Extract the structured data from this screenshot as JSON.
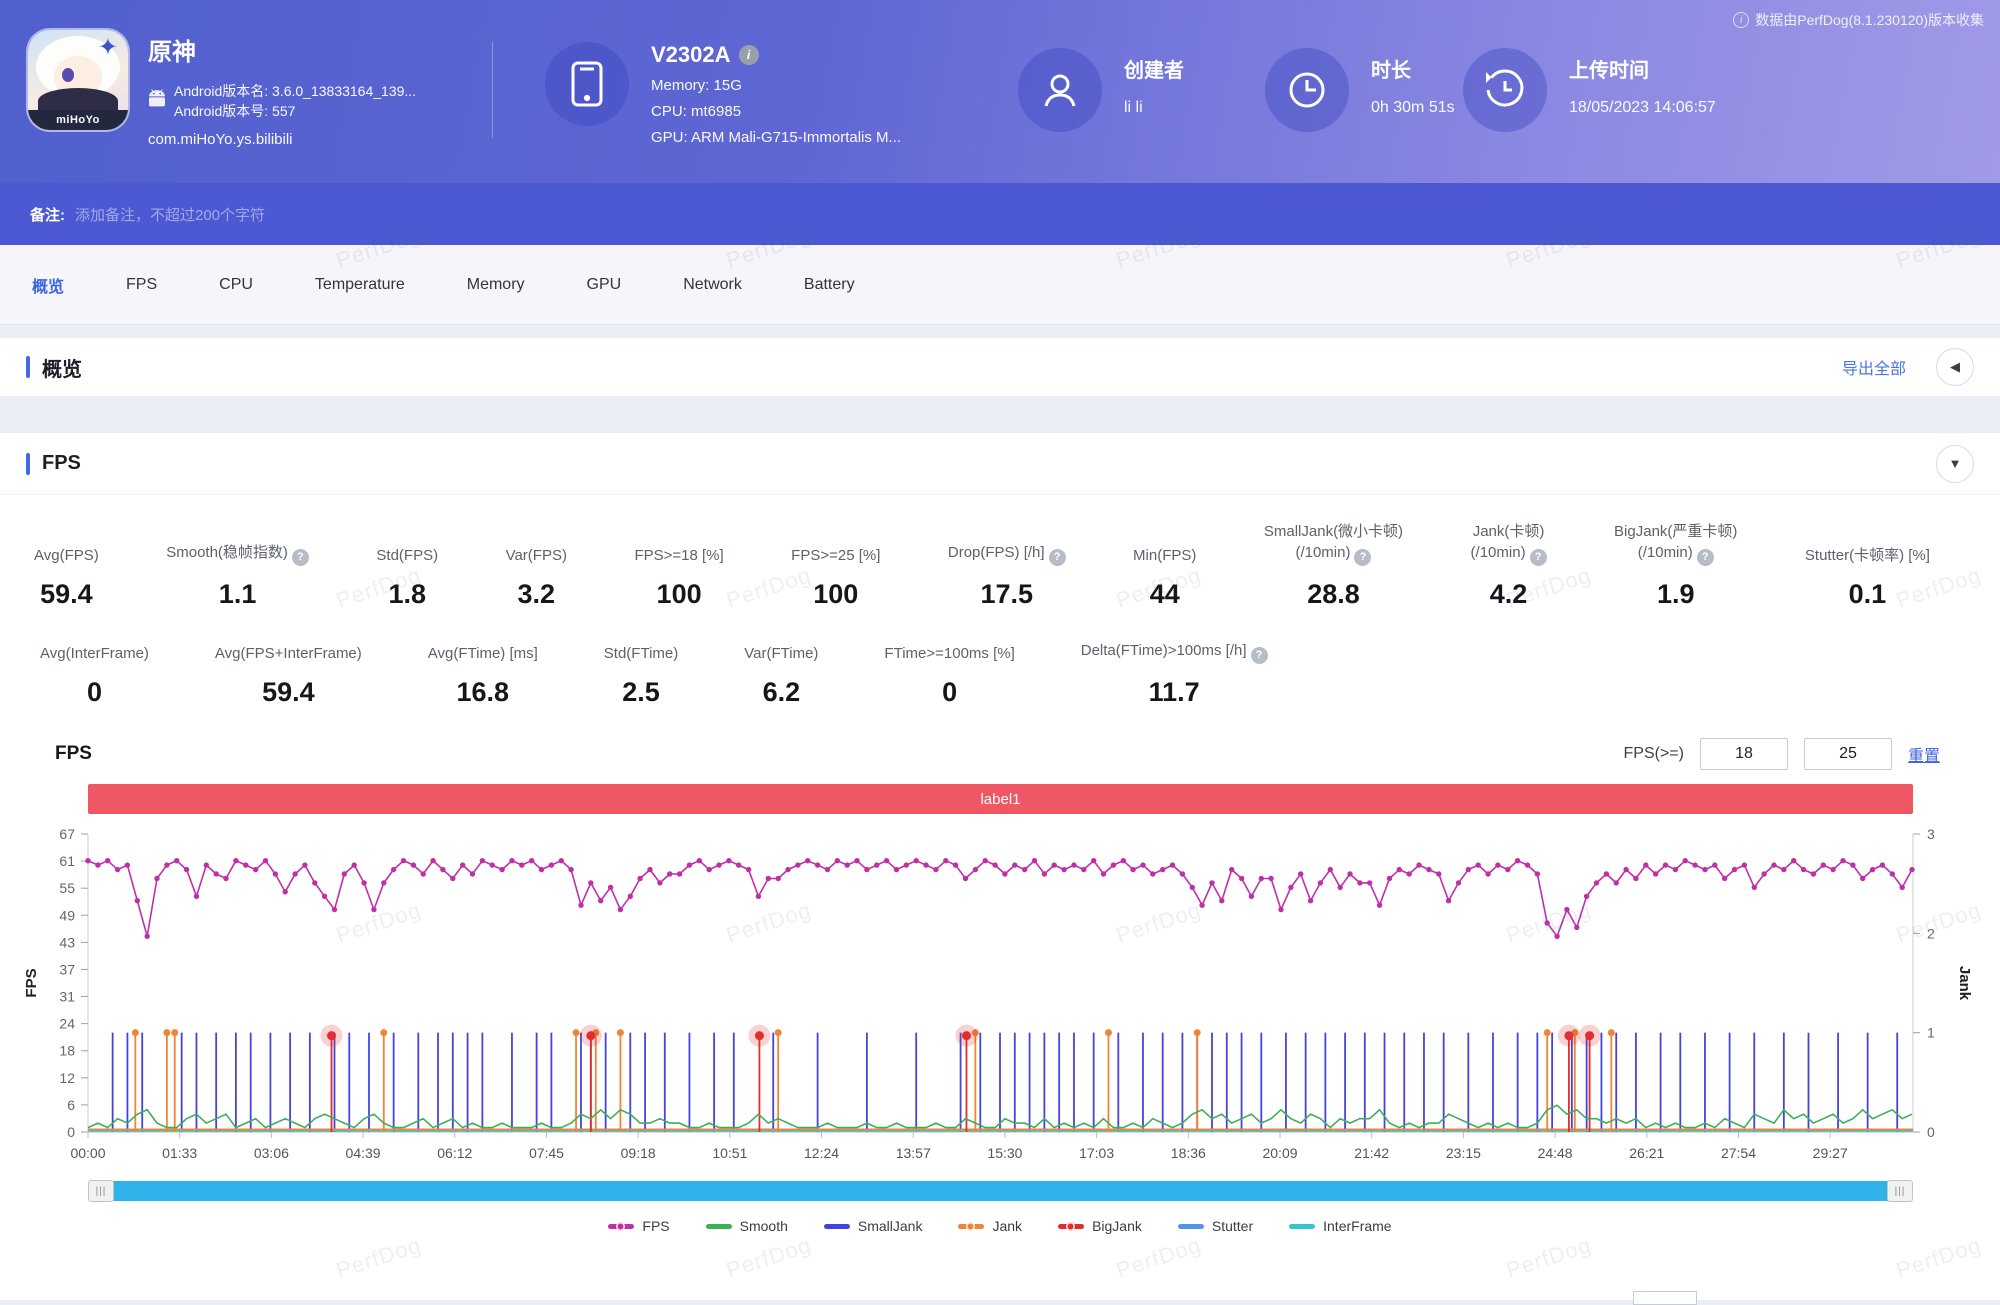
{
  "meta": {
    "collector_note": "数据由PerfDog(8.1.230120)版本收集"
  },
  "watermark": "PerfDog",
  "header": {
    "app": {
      "title": "原神",
      "version_name": "Android版本名: 3.6.0_13833164_139...",
      "version_code": "Android版本号: 557",
      "package": "com.miHoYo.ys.bilibili",
      "icon_badge": "miHoYo"
    },
    "device": {
      "model": "V2302A",
      "memory": "Memory: 15G",
      "cpu": "CPU: mt6985",
      "gpu": "GPU: ARM Mali-G715-Immortalis M..."
    },
    "creator": {
      "label": "创建者",
      "value": "li li"
    },
    "duration": {
      "label": "时长",
      "value": "0h 30m 51s"
    },
    "upload": {
      "label": "上传时间",
      "value": "18/05/2023 14:06:57"
    }
  },
  "remark": {
    "label": "备注:",
    "placeholder": "添加备注，不超过200个字符"
  },
  "tabs": [
    {
      "label": "概览",
      "active": true
    },
    {
      "label": "FPS",
      "active": false
    },
    {
      "label": "CPU",
      "active": false
    },
    {
      "label": "Temperature",
      "active": false
    },
    {
      "label": "Memory",
      "active": false
    },
    {
      "label": "GPU",
      "active": false
    },
    {
      "label": "Network",
      "active": false
    },
    {
      "label": "Battery",
      "active": false
    }
  ],
  "overview": {
    "title": "概览",
    "export_label": "导出全部"
  },
  "fps_section": {
    "title": "FPS",
    "chart_title": "FPS",
    "threshold": {
      "label": "FPS(>=)",
      "input1": "18",
      "input2": "25",
      "reset": "重置"
    },
    "banner": "label1",
    "stats_row1": [
      {
        "label": "Avg(FPS)",
        "value": "59.4",
        "help": false
      },
      {
        "label": "Smooth(稳帧指数)",
        "value": "1.1",
        "help": true
      },
      {
        "label": "Std(FPS)",
        "value": "1.8",
        "help": false
      },
      {
        "label": "Var(FPS)",
        "value": "3.2",
        "help": false
      },
      {
        "label": "FPS>=18 [%]",
        "value": "100",
        "help": false
      },
      {
        "label": "FPS>=25 [%]",
        "value": "100",
        "help": false
      },
      {
        "label": "Drop(FPS) [/h]",
        "value": "17.5",
        "help": true
      },
      {
        "label": "Min(FPS)",
        "value": "44",
        "help": false
      },
      {
        "label": "SmallJank(微小卡顿)\n(/10min)",
        "value": "28.8",
        "help": true
      },
      {
        "label": "Jank(卡顿)\n(/10min)",
        "value": "4.2",
        "help": true
      },
      {
        "label": "BigJank(严重卡顿)\n(/10min)",
        "value": "1.9",
        "help": true
      },
      {
        "label": "Stutter(卡顿率) [%]",
        "value": "0.1",
        "help": false
      }
    ],
    "stats_row2": [
      {
        "label": "Avg(InterFrame)",
        "value": "0",
        "help": false
      },
      {
        "label": "Avg(FPS+InterFrame)",
        "value": "59.4",
        "help": false
      },
      {
        "label": "Avg(FTime) [ms]",
        "value": "16.8",
        "help": false
      },
      {
        "label": "Std(FTime)",
        "value": "2.5",
        "help": false
      },
      {
        "label": "Var(FTime)",
        "value": "6.2",
        "help": false
      },
      {
        "label": "FTime>=100ms [%]",
        "value": "0",
        "help": false
      },
      {
        "label": "Delta(FTime)>100ms [/h]",
        "value": "11.7",
        "help": true
      }
    ]
  },
  "chart_data": {
    "type": "line",
    "title": "FPS",
    "duration_s": 1851,
    "x_ticks": [
      "00:00",
      "01:33",
      "03:06",
      "04:39",
      "06:12",
      "07:45",
      "09:18",
      "10:51",
      "12:24",
      "13:57",
      "15:30",
      "17:03",
      "18:36",
      "20:09",
      "21:42",
      "23:15",
      "24:48",
      "26:21",
      "27:54",
      "29:27"
    ],
    "x_tick_interval_s": 93,
    "y_left": {
      "label": "FPS",
      "ticks": [
        67,
        61,
        55,
        49,
        43,
        37,
        31,
        24,
        18,
        12,
        6,
        0
      ],
      "max": 67
    },
    "y_right": {
      "label": "Jank",
      "ticks": [
        3,
        2,
        1,
        0
      ],
      "max": 3
    },
    "grid": false,
    "legend_position": "bottom",
    "series": [
      {
        "name": "FPS",
        "color": "#bf30a8",
        "axis": "left",
        "kind": "line-dots",
        "dt": 10,
        "values": [
          61,
          60,
          61,
          59,
          60,
          52,
          44,
          57,
          60,
          61,
          59,
          53,
          60,
          58,
          57,
          61,
          60,
          59,
          61,
          58,
          54,
          58,
          60,
          56,
          53,
          50,
          58,
          60,
          56,
          50,
          56,
          59,
          61,
          60,
          58,
          61,
          59,
          57,
          60,
          58,
          61,
          60,
          59,
          61,
          60,
          61,
          59,
          60,
          61,
          59,
          51,
          56,
          52,
          55,
          50,
          53,
          57,
          59,
          56,
          58,
          58,
          60,
          61,
          59,
          60,
          61,
          60,
          59,
          53,
          57,
          57,
          59,
          60,
          61,
          60,
          59,
          61,
          60,
          61,
          59,
          60,
          61,
          59,
          60,
          61,
          60,
          59,
          61,
          60,
          57,
          59,
          61,
          60,
          58,
          60,
          59,
          61,
          58,
          60,
          59,
          60,
          59,
          61,
          58,
          60,
          61,
          59,
          60,
          58,
          59,
          60,
          58,
          55,
          51,
          56,
          52,
          59,
          57,
          53,
          57,
          57,
          50,
          55,
          58,
          52,
          56,
          59,
          55,
          58,
          56,
          56,
          51,
          57,
          59,
          58,
          60,
          59,
          58,
          52,
          56,
          59,
          60,
          58,
          60,
          59,
          61,
          60,
          58,
          47,
          44,
          50,
          46,
          53,
          56,
          58,
          56,
          59,
          57,
          60,
          58,
          60,
          59,
          61,
          60,
          59,
          60,
          57,
          59,
          60,
          55,
          58,
          60,
          59,
          61,
          59,
          58,
          60,
          59,
          61,
          60,
          57,
          59,
          60,
          58,
          55,
          59
        ]
      },
      {
        "name": "Smooth",
        "color": "#3fae58",
        "axis": "left",
        "kind": "line",
        "dt": 10,
        "values": [
          1,
          2,
          1,
          3,
          2,
          4,
          5,
          2,
          1,
          1,
          3,
          4,
          2,
          3,
          4,
          1,
          2,
          3,
          1,
          2,
          3,
          2,
          1,
          3,
          4,
          3,
          2,
          1,
          3,
          4,
          2,
          1,
          1,
          2,
          3,
          1,
          2,
          3,
          1,
          2,
          1,
          1,
          2,
          1,
          1,
          1,
          2,
          1,
          1,
          2,
          4,
          3,
          5,
          3,
          5,
          4,
          2,
          2,
          3,
          2,
          2,
          1,
          1,
          2,
          1,
          1,
          1,
          2,
          4,
          2,
          3,
          2,
          1,
          1,
          1,
          2,
          1,
          1,
          1,
          2,
          1,
          1,
          2,
          1,
          1,
          1,
          2,
          1,
          1,
          3,
          2,
          1,
          1,
          3,
          2,
          2,
          1,
          3,
          1,
          2,
          1,
          2,
          1,
          3,
          1,
          1,
          2,
          1,
          3,
          2,
          1,
          2,
          4,
          5,
          3,
          4,
          2,
          3,
          4,
          2,
          3,
          5,
          3,
          2,
          4,
          3,
          1,
          3,
          2,
          3,
          3,
          5,
          2,
          1,
          2,
          1,
          2,
          2,
          4,
          3,
          2,
          1,
          2,
          1,
          2,
          1,
          1,
          2,
          5,
          6,
          4,
          5,
          3,
          3,
          2,
          3,
          2,
          3,
          1,
          2,
          1,
          2,
          1,
          1,
          2,
          1,
          3,
          2,
          1,
          4,
          3,
          2,
          5,
          3,
          4,
          2,
          3,
          4,
          2,
          3,
          5,
          3,
          4,
          5,
          3,
          4
        ]
      },
      {
        "name": "SmallJank",
        "color": "#4444dd",
        "axis": "right",
        "kind": "events",
        "value": 1,
        "marker": false,
        "halo": false,
        "times": [
          25,
          40,
          55,
          95,
          110,
          130,
          150,
          165,
          185,
          205,
          225,
          250,
          265,
          285,
          310,
          335,
          355,
          370,
          385,
          400,
          430,
          455,
          470,
          500,
          510,
          525,
          550,
          565,
          585,
          610,
          635,
          655,
          695,
          740,
          790,
          840,
          885,
          905,
          925,
          940,
          955,
          970,
          985,
          1000,
          1020,
          1045,
          1070,
          1090,
          1110,
          1125,
          1140,
          1155,
          1170,
          1190,
          1215,
          1235,
          1255,
          1275,
          1295,
          1315,
          1335,
          1355,
          1375,
          1400,
          1425,
          1450,
          1470,
          1485,
          1505,
          1520,
          1535,
          1550,
          1570,
          1595,
          1615,
          1640,
          1665,
          1690,
          1720,
          1745,
          1775,
          1805,
          1835
        ]
      },
      {
        "name": "Jank",
        "color": "#ef8535",
        "axis": "right",
        "kind": "events",
        "value": 1,
        "marker": true,
        "halo": false,
        "baseline": true,
        "times": [
          48,
          80,
          88,
          300,
          495,
          515,
          540,
          700,
          900,
          1035,
          1125,
          1480,
          1508,
          1545
        ]
      },
      {
        "name": "BigJank",
        "color": "#e02e2e",
        "axis": "right",
        "kind": "events",
        "value": 0.97,
        "marker": true,
        "halo": true,
        "times": [
          247,
          510,
          681,
          891,
          1502,
          1523
        ]
      },
      {
        "name": "Stutter",
        "color": "#5692e8",
        "axis": "right",
        "kind": "flat",
        "value": 0
      },
      {
        "name": "InterFrame",
        "color": "#35c6d6",
        "axis": "left",
        "kind": "flat",
        "value": 0
      }
    ]
  },
  "legend": [
    {
      "label": "FPS",
      "color": "#bf30a8",
      "dot": true
    },
    {
      "label": "Smooth",
      "color": "#3fae58",
      "dot": false
    },
    {
      "label": "SmallJank",
      "color": "#4444dd",
      "dot": false
    },
    {
      "label": "Jank",
      "color": "#ef8535",
      "dot": true
    },
    {
      "label": "BigJank",
      "color": "#e02e2e",
      "dot": true
    },
    {
      "label": "Stutter",
      "color": "#5692e8",
      "dot": false
    },
    {
      "label": "InterFrame",
      "color": "#35c6d6",
      "dot": false
    }
  ]
}
